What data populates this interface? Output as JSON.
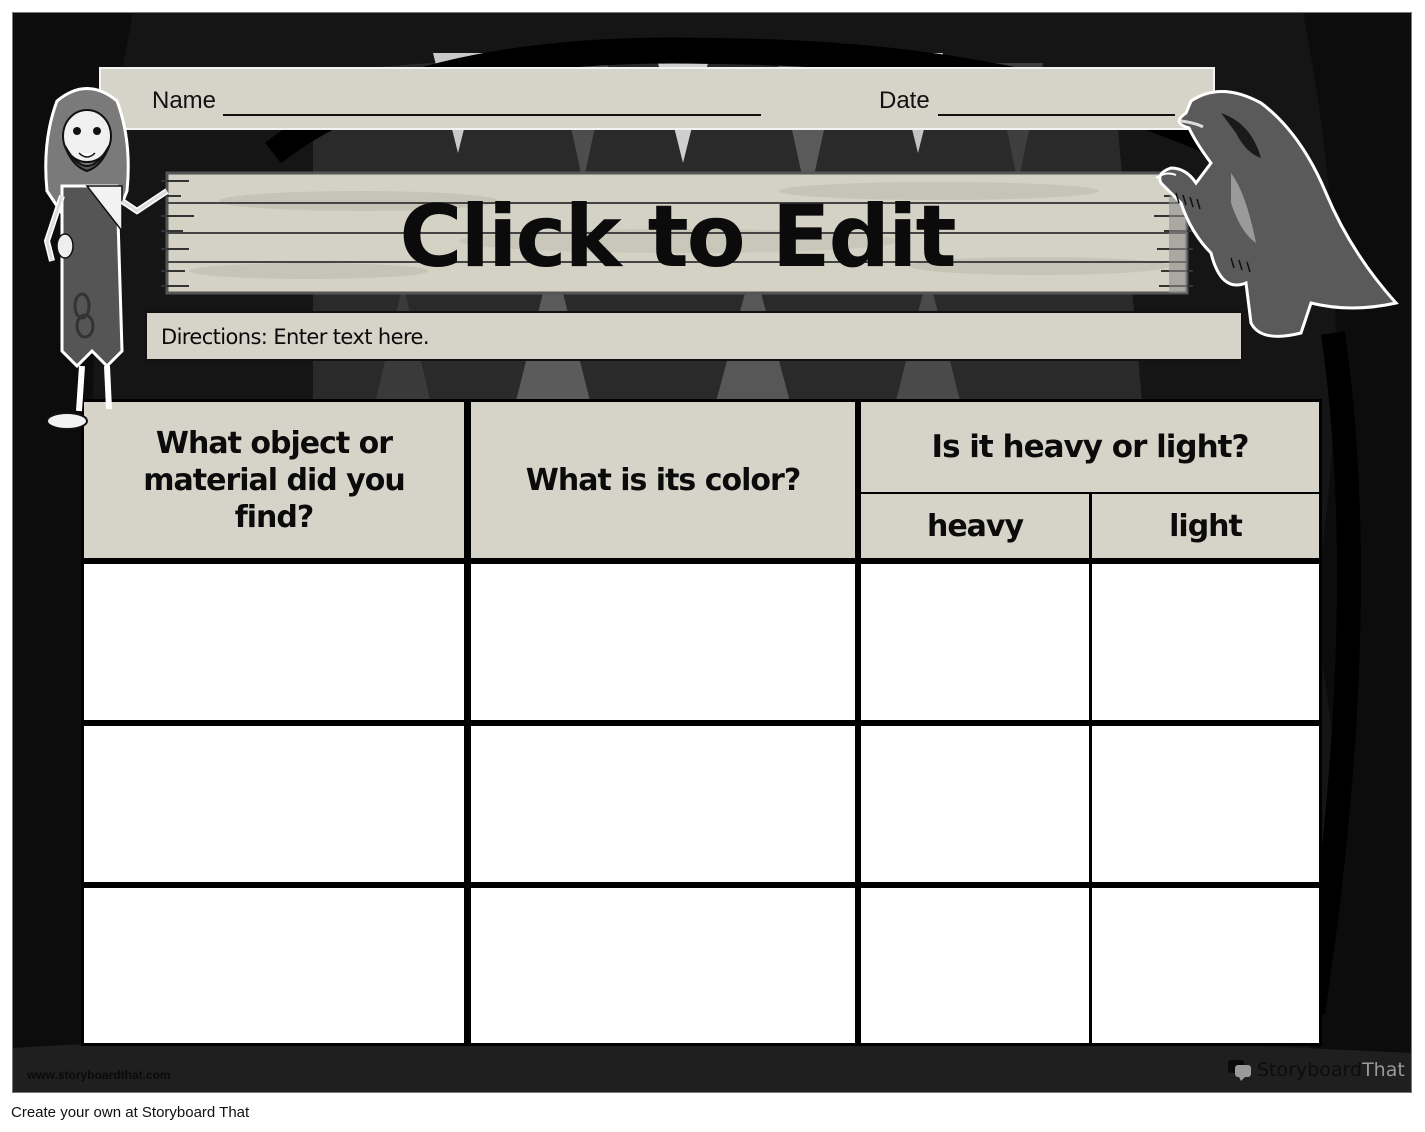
{
  "worksheet": {
    "name_label": "Name",
    "date_label": "Date",
    "title": "Click to Edit",
    "directions": "Directions: Enter text here."
  },
  "table": {
    "headers": {
      "col1": "What object or material did you find?",
      "col2": "What is its color?",
      "col3_group": "Is it heavy or light?",
      "col3_sub": [
        "heavy",
        "light"
      ]
    },
    "rows": [
      [
        "",
        "",
        "",
        ""
      ],
      [
        "",
        "",
        "",
        ""
      ],
      [
        "",
        "",
        "",
        ""
      ]
    ]
  },
  "characters": {
    "left": "caveman",
    "right": "ground-sloth"
  },
  "branding": {
    "watermark_url": "www.storyboardthat.com",
    "logo_story": "Storyboard",
    "logo_that": "That",
    "footer_credit": "Create your own at Storyboard That"
  },
  "colors": {
    "panel_bg": "#141414",
    "label_bg": "#d6d4c8",
    "cell_bg": "#ffffff",
    "ink": "#0b0b0b"
  }
}
